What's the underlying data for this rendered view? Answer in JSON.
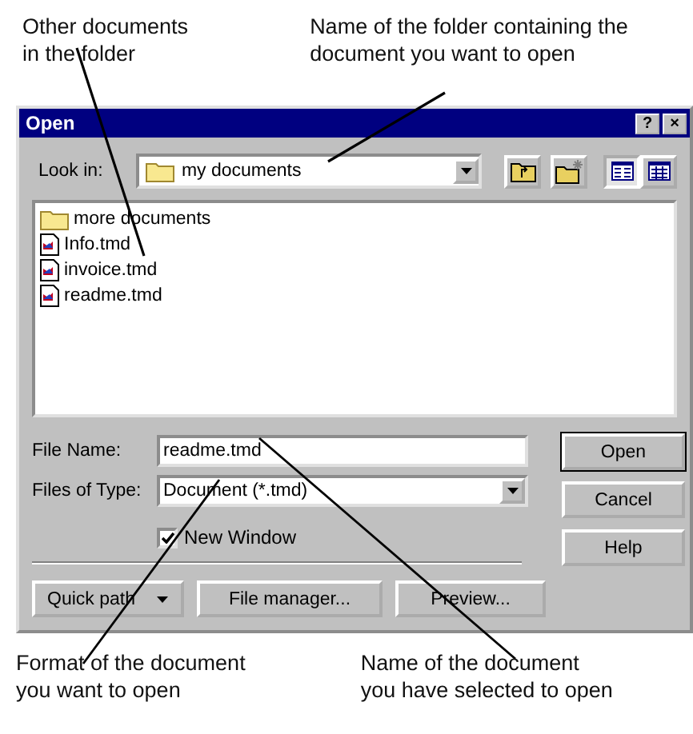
{
  "annotations_top": [
    {
      "text": "Other documents\nin the folder"
    },
    {
      "text": "Name of the folder containing the\ndocument you want to open"
    }
  ],
  "window": {
    "title": "Open",
    "title_buttons": [
      "?",
      "×"
    ]
  },
  "look_in": {
    "label": "Look in:",
    "value": "my documents"
  },
  "toolbar": [
    {
      "kind": "up",
      "selected": false
    },
    {
      "kind": "new_folder",
      "selected": false
    },
    {
      "kind": "list",
      "selected": true
    },
    {
      "kind": "details",
      "selected": false
    }
  ],
  "files": [
    {
      "kind": "folder",
      "name": "more documents"
    },
    {
      "kind": "document",
      "name": "Info.tmd"
    },
    {
      "kind": "document",
      "name": "invoice.tmd"
    },
    {
      "kind": "document",
      "name": "readme.tmd"
    }
  ],
  "file_name": {
    "label": "File Name:",
    "value": "readme.tmd"
  },
  "file_type": {
    "label": "Files of Type:",
    "value": "Document (*.tmd)"
  },
  "new_window": {
    "label": "New Window",
    "checked": true
  },
  "side_buttons": [
    {
      "label": "Open",
      "default": true
    },
    {
      "label": "Cancel",
      "default": false
    },
    {
      "label": "Help",
      "default": false
    }
  ],
  "bottom_buttons": [
    {
      "label": "Quick path",
      "kind": "menu"
    },
    {
      "label": "File manager...",
      "kind": "plain"
    },
    {
      "label": "Preview...",
      "kind": "plain"
    }
  ],
  "annotations_bottom": [
    {
      "text": "Format of the document\nyou want to open"
    },
    {
      "text": "Name of the document\nyou have selected to open"
    }
  ]
}
